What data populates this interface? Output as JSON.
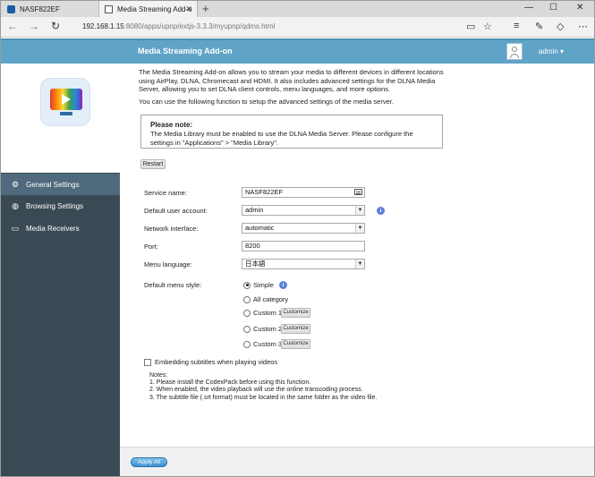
{
  "browser": {
    "tabs": [
      {
        "title": "NASF822EF",
        "icon": "qnap-icon"
      },
      {
        "title": "Media Streaming Add-o",
        "icon": "page-icon"
      }
    ],
    "url_host": "192.168.1.15",
    "url_rest": ":8080/apps/upnp/extjs-3.3.3/myupnp/qdms.html"
  },
  "header": {
    "title": "Media Streaming Add-on",
    "user": "admin",
    "user_arrow": "▾",
    "bg_color": "#5fa3c7"
  },
  "intro": {
    "description": "The Media Streaming Add-on allows you to stream your media to different devices in different locations using AirPlay, DLNA, Chromecast and HDMI. It also includes advanced settings for the DLNA Media Server, allowing you to set DLNA client controls, menu languages, and more options.",
    "usage": "You can use the following function to setup the advanced settings of the media server.",
    "note_title": "Please note:",
    "note_text": "The Media Library must be enabled to use the DLNA Media Server. Please configure the settings in \"Applications\" > \"Media Library\".",
    "restart_label": "Restart"
  },
  "sidebar": {
    "items": [
      {
        "label": "General Settings",
        "icon": "gear-icon",
        "active": true
      },
      {
        "label": "Browsing Settings",
        "icon": "globe-icon",
        "active": false
      },
      {
        "label": "Media Receivers",
        "icon": "monitor-icon",
        "active": false
      }
    ]
  },
  "form": {
    "service_name_label": "Service name:",
    "service_name_value": "NASF822EF",
    "default_user_label": "Default user account:",
    "default_user_value": "admin",
    "network_interface_label": "Network interface:",
    "network_interface_value": "automatic",
    "port_label": "Port:",
    "port_value": "8200",
    "menu_language_label": "Menu language:",
    "menu_language_value": "日本語",
    "menu_style_label": "Default menu style:",
    "menu_style_options": [
      "Simple",
      "All category",
      "Custom 1",
      "Custom 2",
      "Custom 3"
    ],
    "menu_style_selected": "Simple",
    "customize_label": "Customize",
    "embed_subtitles_label": "Embedding subtitles when playing videos",
    "notes_title": "Notes:",
    "notes": [
      "1. Please install the CodexPack before using this function.",
      "2. When enabled, the video playback will use the online transcoding process.",
      "3. The subtitle file (.srt format) must be located in the same folder as the video file."
    ]
  },
  "footer": {
    "apply_label": "Apply All"
  }
}
